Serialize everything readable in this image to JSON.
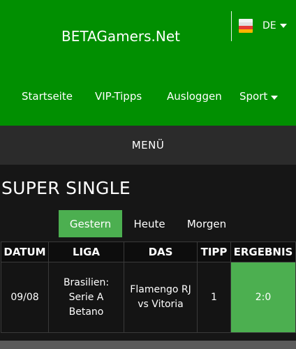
{
  "header": {
    "brand": "BETAGamers.Net",
    "language": {
      "code": "DE",
      "flag_colors": [
        "#f4f4f4",
        "#e6e6e6",
        "#e53935",
        "#ffb300"
      ]
    },
    "nav": [
      {
        "label": "Startseite"
      },
      {
        "label": "VIP-Tipps"
      },
      {
        "label": "Ausloggen"
      },
      {
        "label": "Sport"
      }
    ]
  },
  "menu": {
    "label": "MENÜ"
  },
  "section": {
    "title": "SUPER SINGLE"
  },
  "tabs": [
    {
      "label": "Gestern",
      "active": true
    },
    {
      "label": "Heute",
      "active": false
    },
    {
      "label": "Morgen",
      "active": false
    }
  ],
  "table": {
    "headers": [
      "DATUM",
      "LIGA",
      "DAS",
      "TIPP",
      "ERGEBNIS"
    ],
    "rows": [
      {
        "date": "09/08",
        "league": [
          "Brasilien:",
          "Serie A",
          "Betano"
        ],
        "match": [
          "Flamengo RJ",
          "vs Vitoria"
        ],
        "tip": "1",
        "result": "2:0"
      }
    ]
  },
  "colors": {
    "header_green": "#018f01",
    "accent_green": "#4caf50",
    "menubar": "#2b2b2b",
    "background": "#161616"
  }
}
